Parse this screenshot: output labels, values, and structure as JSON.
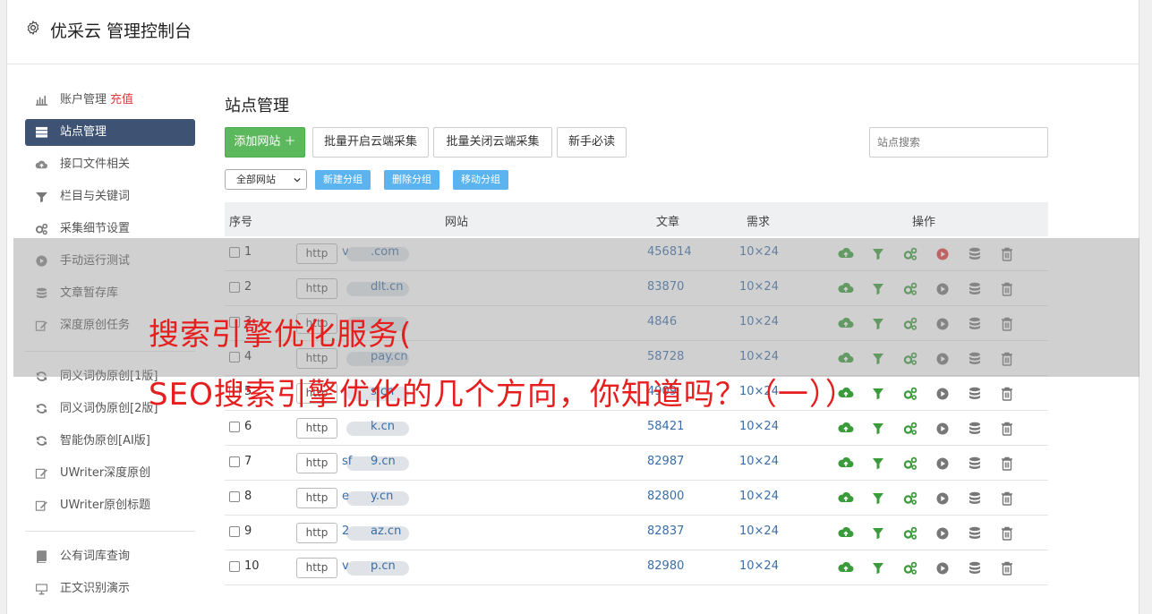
{
  "header": {
    "title": "优采云 管理控制台"
  },
  "sidebar": {
    "items": [
      {
        "label": "账户管理",
        "extra": "充值",
        "icon": "bar-chart-icon"
      },
      {
        "label": "站点管理",
        "icon": "server-icon",
        "active": true
      },
      {
        "label": "接口文件相关",
        "icon": "cloud-upload-icon"
      },
      {
        "label": "栏目与关键词",
        "icon": "filter-icon"
      },
      {
        "label": "采集细节设置",
        "icon": "gears-icon"
      },
      {
        "label": "手动运行测试",
        "icon": "play-circle-icon"
      },
      {
        "label": "文章暂存库",
        "icon": "database-icon"
      },
      {
        "label": "深度原创任务",
        "icon": "edit-icon"
      },
      {
        "label": "同义词伪原创[1版]",
        "icon": "refresh-icon"
      },
      {
        "label": "同义词伪原创[2版]",
        "icon": "refresh-icon"
      },
      {
        "label": "智能伪原创[AI版]",
        "icon": "refresh-icon"
      },
      {
        "label": "UWriter深度原创",
        "icon": "edit-icon"
      },
      {
        "label": "UWriter原创标题",
        "icon": "edit-icon"
      },
      {
        "label": "公有词库查询",
        "icon": "book-icon"
      },
      {
        "label": "正文识别演示",
        "icon": "monitor-icon"
      }
    ]
  },
  "main": {
    "heading": "站点管理",
    "buttons": {
      "add": "添加网站 ＋",
      "batch_on": "批量开启云端采集",
      "batch_off": "批量关闭云端采集",
      "guide": "新手必读"
    },
    "search_placeholder": "站点搜索",
    "group_select": "全部网站",
    "group_buttons": {
      "new": "新建分组",
      "delete": "删除分组",
      "move": "移动分组"
    },
    "columns": {
      "index": "序号",
      "site": "网站",
      "articles": "文章",
      "demand": "需求",
      "ops": "操作"
    },
    "rows": [
      {
        "num": "1",
        "proto": "http",
        "prefix": "v",
        "suffix": ".com",
        "articles": "456814",
        "demand": "10×24",
        "running": true
      },
      {
        "num": "2",
        "proto": "http",
        "prefix": "",
        "suffix": "dlt.cn",
        "articles": "83870",
        "demand": "10×24",
        "running": false
      },
      {
        "num": "3",
        "proto": "http",
        "prefix": "",
        "suffix": "",
        "articles": "4846",
        "demand": "10×24",
        "running": false
      },
      {
        "num": "4",
        "proto": "http",
        "prefix": "",
        "suffix": "pay.cn",
        "articles": "58728",
        "demand": "10×24",
        "running": false
      },
      {
        "num": "5",
        "proto": "http",
        "prefix": "",
        "suffix": "s.cn",
        "articles": "4909",
        "demand": "10×24",
        "running": false
      },
      {
        "num": "6",
        "proto": "http",
        "prefix": "",
        "suffix": "k.cn",
        "articles": "58421",
        "demand": "10×24",
        "running": false
      },
      {
        "num": "7",
        "proto": "http",
        "prefix": "sf",
        "suffix": "9.cn",
        "articles": "82987",
        "demand": "10×24",
        "running": false
      },
      {
        "num": "8",
        "proto": "http",
        "prefix": "e",
        "suffix": "y.cn",
        "articles": "82800",
        "demand": "10×24",
        "running": false
      },
      {
        "num": "9",
        "proto": "http",
        "prefix": "2",
        "suffix": "az.cn",
        "articles": "82837",
        "demand": "10×24",
        "running": false
      },
      {
        "num": "10",
        "proto": "http",
        "prefix": "v",
        "suffix": "p.cn",
        "articles": "82980",
        "demand": "10×24",
        "running": false
      }
    ]
  },
  "overlay": {
    "line1": "搜索引擎优化服务(",
    "line2": "SEO搜索引擎优化的几个方向，你知道吗？（一））"
  },
  "colors": {
    "accent": "#3e5373",
    "green": "#5cb85c",
    "link": "#3a6da8",
    "overlay_text": "#e61e1e",
    "sub_button": "#5bb4f0"
  }
}
